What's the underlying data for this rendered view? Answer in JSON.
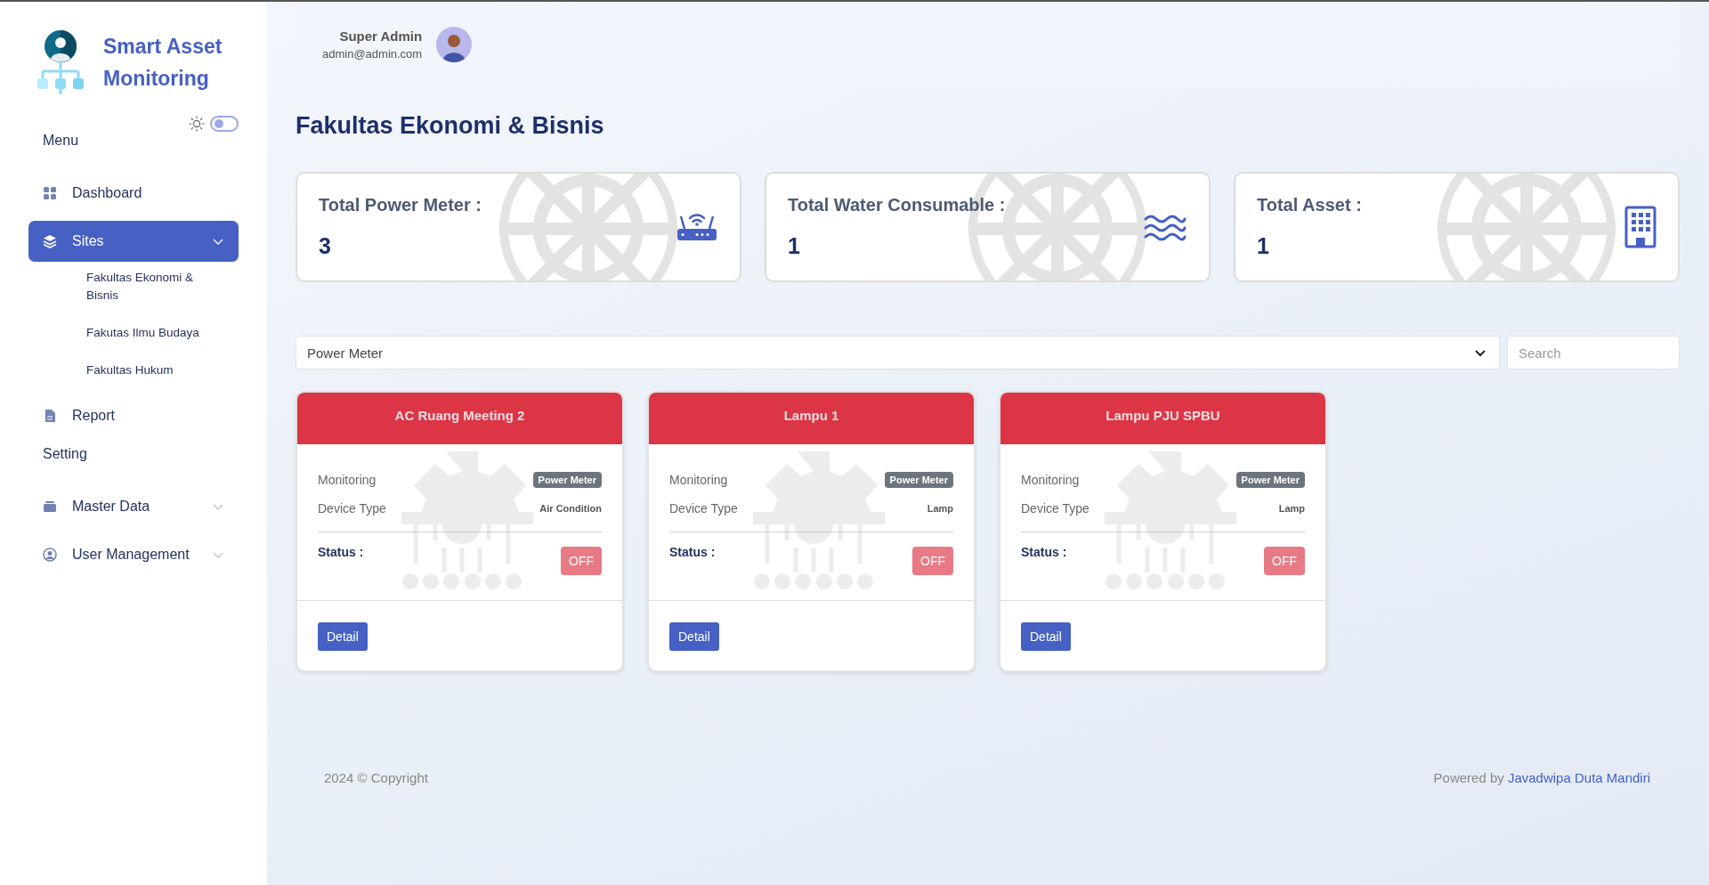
{
  "sidebar": {
    "brand": "Smart Asset Monitoring",
    "theme_toggle": {
      "on": false
    },
    "sections": [
      {
        "title": "Menu",
        "items": [
          {
            "label": "Dashboard",
            "kind": "link",
            "selected": false
          },
          {
            "label": "Sites",
            "kind": "group",
            "selected": true,
            "expanded": true,
            "children": [
              {
                "label": "Fakultas Ekonomi & Bisnis"
              },
              {
                "label": "Fakutas Ilmu Budaya"
              },
              {
                "label": "Fakultas Hukum"
              }
            ]
          },
          {
            "label": "Report",
            "kind": "link",
            "selected": false
          }
        ]
      },
      {
        "title": "Setting",
        "items": [
          {
            "label": "Master Data",
            "kind": "group",
            "selected": false,
            "expanded": false
          },
          {
            "label": "User Management",
            "kind": "group",
            "selected": false,
            "expanded": false
          }
        ]
      }
    ]
  },
  "user": {
    "name": "Super Admin",
    "email": "admin@admin.com"
  },
  "page_title": "Fakultas Ekonomi & Bisnis",
  "stats": [
    {
      "label": "Total Power Meter :",
      "value": "3"
    },
    {
      "label": "Total Water Consumable :",
      "value": "1"
    },
    {
      "label": "Total Asset :",
      "value": "1"
    }
  ],
  "filter": {
    "value": "Power Meter"
  },
  "search": {
    "placeholder": "Search"
  },
  "devices": [
    {
      "name": "AC Ruang Meeting 2",
      "monitoring_label": "Monitoring",
      "monitoring": "Power Meter",
      "type_label": "Device Type",
      "type": "Air Condition",
      "status_label": "Status :",
      "status": "OFF",
      "on": false,
      "button": "Detail"
    },
    {
      "name": "Lampu 1",
      "monitoring_label": "Monitoring",
      "monitoring": "Power Meter",
      "type_label": "Device Type",
      "type": "Lamp",
      "status_label": "Status :",
      "status": "OFF",
      "on": false,
      "button": "Detail"
    },
    {
      "name": "Lampu PJU SPBU",
      "monitoring_label": "Monitoring",
      "monitoring": "Power Meter",
      "type_label": "Device Type",
      "type": "Lamp",
      "status_label": "Status :",
      "status": "OFF",
      "on": false,
      "button": "Detail"
    }
  ],
  "footer": {
    "copyright": "2024 © Copyright",
    "powered_prefix": "Powered by",
    "powered_link": "Javadwipa Duta Mandiri"
  }
}
